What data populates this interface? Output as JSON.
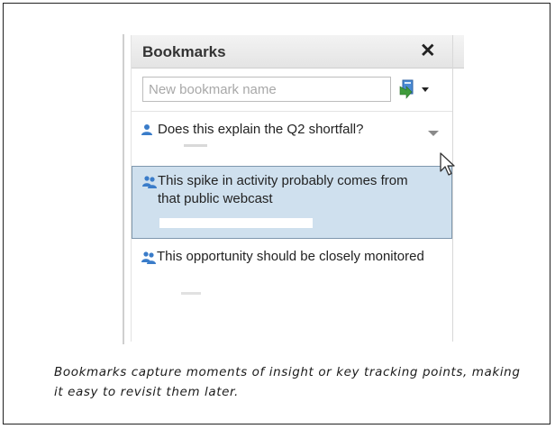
{
  "panel": {
    "title": "Bookmarks",
    "close_label": "✕",
    "new_bookmark": {
      "placeholder": "New bookmark name",
      "value": ""
    },
    "add_button_icon": "add-bookmark-icon",
    "items": [
      {
        "text": "Does this explain the Q2 shortfall?",
        "icon": "single-user-icon",
        "selected": false
      },
      {
        "text": "This spike in activity probably comes from that public webcast",
        "icon": "shared-users-icon",
        "selected": true
      },
      {
        "text": "This opportunity should be closely monitored",
        "icon": "shared-users-icon",
        "selected": false
      }
    ]
  },
  "caption": "Bookmarks capture moments of insight or key tracking points, making it easy to revisit them later.",
  "colors": {
    "selected_row": "#cfe0ee",
    "selected_border": "#7e97ad",
    "icon_blue": "#3a7cc9",
    "icon_green": "#3f9b3b"
  }
}
